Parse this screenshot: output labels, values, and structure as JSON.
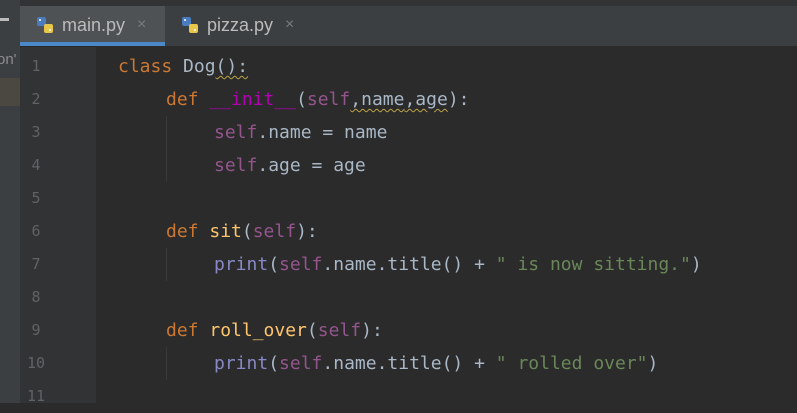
{
  "sidebar": {
    "fragment": "on'"
  },
  "tabs": [
    {
      "label": "main.py",
      "close": "×",
      "active": true
    },
    {
      "label": "pizza.py",
      "close": "×",
      "active": false
    }
  ],
  "line_numbers": [
    "1",
    "2",
    "3",
    "4",
    "5",
    "6",
    "7",
    "8",
    "9",
    "10",
    "11"
  ],
  "code": {
    "l1": {
      "kw": "class",
      "name": "Dog",
      "rest": "():"
    },
    "l2": {
      "kw": "def",
      "name": "__init__",
      "open": "(",
      "self": "self",
      "p1": ",name",
      "p2": ",age",
      "close": "):"
    },
    "l3": {
      "self": "self",
      "rest": ".name = name"
    },
    "l4": {
      "self": "self",
      "rest": ".age = age"
    },
    "l6": {
      "kw": "def",
      "name": "sit",
      "open": "(",
      "self": "self",
      "close": "):"
    },
    "l7": {
      "fn": "print",
      "open": "(",
      "self": "self",
      "mid": ".name.title() + ",
      "str": "\" is now sitting.\"",
      "close": ")"
    },
    "l9": {
      "kw": "def",
      "name": "roll_over",
      "open": "(",
      "self": "self",
      "close": "):"
    },
    "l10": {
      "fn": "print",
      "open": "(",
      "self": "self",
      "mid": ".name.title() + ",
      "str": "\" rolled over\"",
      "close": ")"
    }
  },
  "colors": {
    "background": "#2b2b2b",
    "keyword": "#cc7832",
    "function": "#ffc66d",
    "self": "#94558d",
    "magic": "#b200b2",
    "string": "#6a8759",
    "default": "#a9b7c6",
    "tab_underline": "#4a88c7"
  },
  "icons": {
    "file": "python-file-icon",
    "fold": "fold-marker-icon"
  }
}
